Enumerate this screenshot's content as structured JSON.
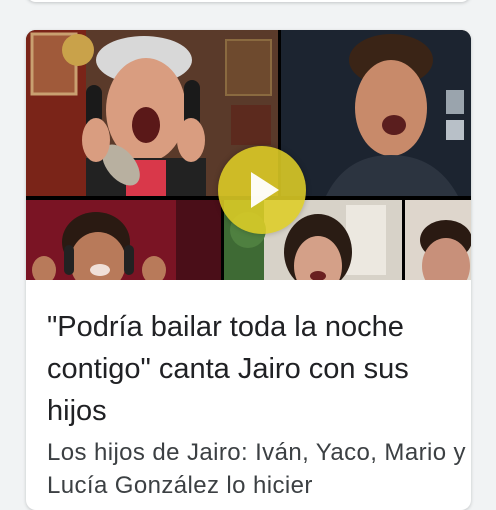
{
  "article": {
    "title": "\"Podría bailar toda la noche contigo\" canta Jairo con sus hijos",
    "snippet": "Los hijos de Jairo: Iván, Yaco, Mario y Lucía González lo hicier",
    "thumbnail_icon": "video-thumbnail",
    "play_icon": "play-icon"
  },
  "colors": {
    "page_background": "#f1f3f4",
    "card_background": "#ffffff",
    "play_button": "#decd26",
    "title_text": "#202124",
    "snippet_text": "#3c4043"
  }
}
